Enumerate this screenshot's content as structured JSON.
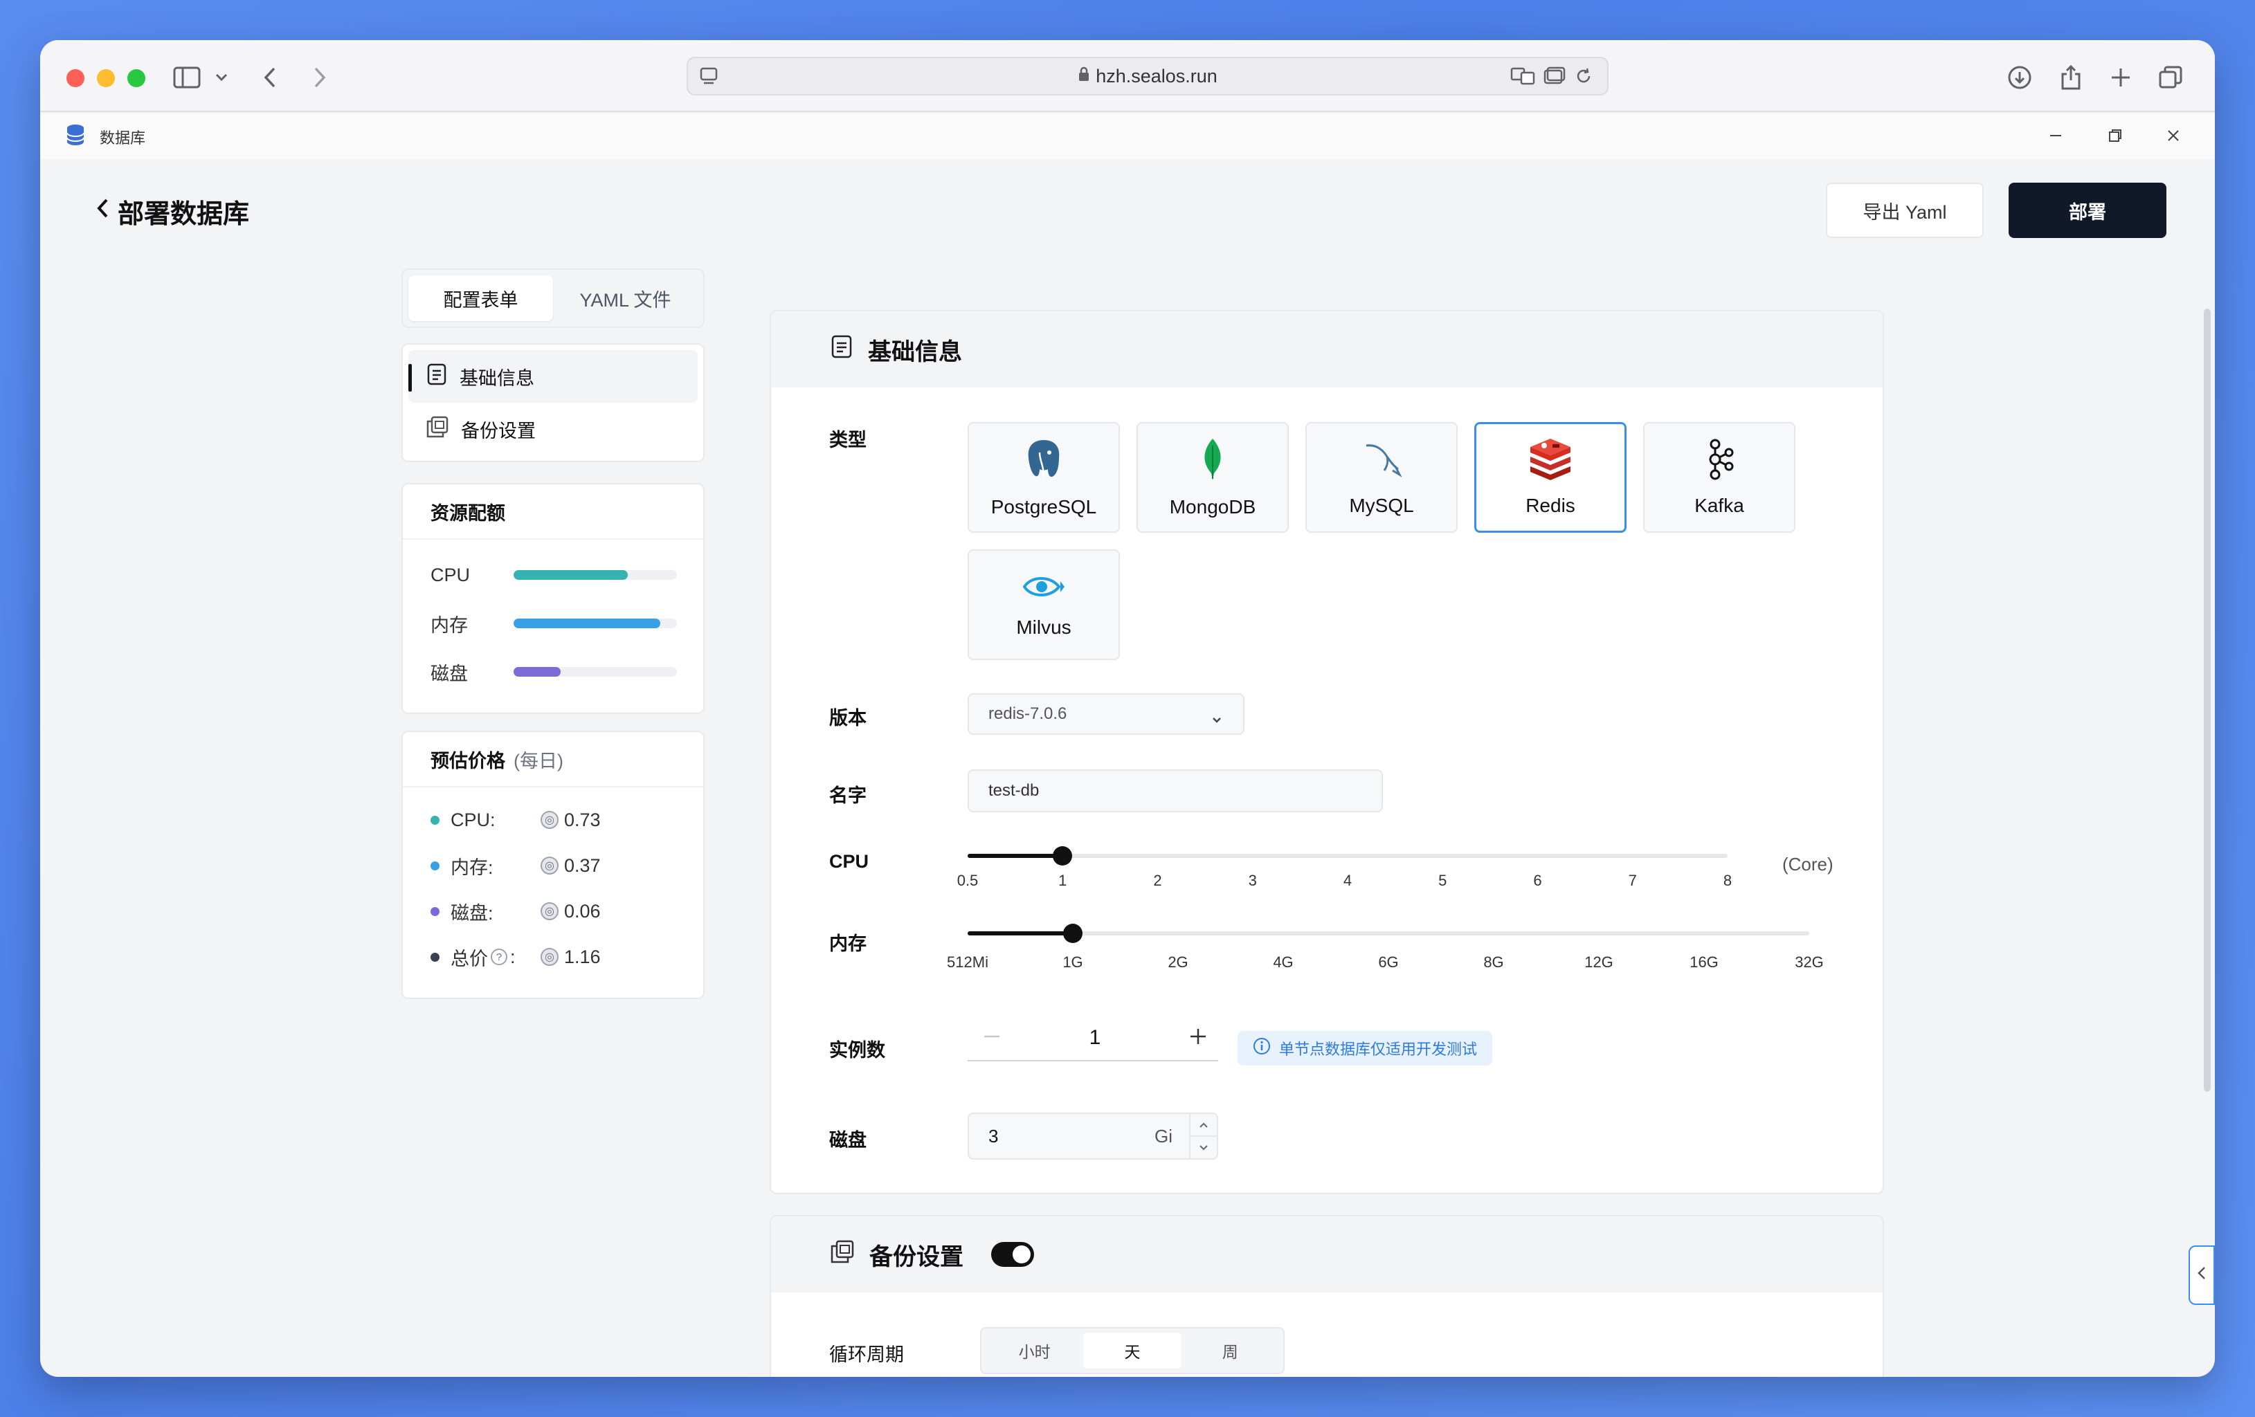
{
  "browser": {
    "url": "hzh.sealos.run"
  },
  "app": {
    "title": "数据库"
  },
  "header": {
    "back_title": "部署数据库",
    "export_label": "导出 Yaml",
    "deploy_label": "部署"
  },
  "sidebar": {
    "tabs": [
      {
        "label": "配置表单",
        "active": true
      },
      {
        "label": "YAML 文件",
        "active": false
      }
    ],
    "nav": [
      {
        "label": "基础信息",
        "active": true
      },
      {
        "label": "备份设置",
        "active": false
      }
    ],
    "resources": {
      "title": "资源配额",
      "items": [
        {
          "label": "CPU",
          "fraction": 0.7,
          "color": "#36b2b0"
        },
        {
          "label": "内存",
          "fraction": 0.9,
          "color": "#3aa0e6"
        },
        {
          "label": "磁盘",
          "fraction": 0.29,
          "color": "#7c6ad6"
        }
      ]
    },
    "price": {
      "title": "预估价格",
      "subtitle": "(每日)",
      "items": [
        {
          "label": "CPU:",
          "value": "0.73",
          "color": "#36b2b0"
        },
        {
          "label": "内存:",
          "value": "0.37",
          "color": "#3aa0e6"
        },
        {
          "label": "磁盘:",
          "value": "0.06",
          "color": "#7c6ad6"
        },
        {
          "label": "总价",
          "value": "1.16",
          "color": "#374151"
        }
      ]
    }
  },
  "main": {
    "title": "基础信息",
    "type_label": "类型",
    "db_types": [
      {
        "name": "PostgreSQL",
        "active": false
      },
      {
        "name": "MongoDB",
        "active": false
      },
      {
        "name": "MySQL",
        "active": false
      },
      {
        "name": "Redis",
        "active": true
      },
      {
        "name": "Kafka",
        "active": false
      },
      {
        "name": "Milvus",
        "active": false
      }
    ],
    "version_label": "版本",
    "version_value": "redis-7.0.6",
    "name_label": "名字",
    "name_value": "test-db",
    "cpu_label": "CPU",
    "cpu_unit": "(Core)",
    "cpu_ticks": [
      "0.5",
      "1",
      "2",
      "3",
      "4",
      "5",
      "6",
      "7",
      "8"
    ],
    "cpu_selected_index": 1,
    "memory_label": "内存",
    "memory_ticks": [
      "512Mi",
      "1G",
      "2G",
      "4G",
      "6G",
      "8G",
      "12G",
      "16G",
      "32G"
    ],
    "memory_selected_index": 1,
    "replicas_label": "实例数",
    "replicas_value": "1",
    "replicas_note": "单节点数据库仅适用开发测试",
    "disk_label": "磁盘",
    "disk_value": "3",
    "disk_unit": "Gi"
  },
  "backup": {
    "title": "备份设置",
    "enabled": true,
    "cycle_label": "循环周期",
    "cycle_options": [
      {
        "label": "小时",
        "active": false
      },
      {
        "label": "天",
        "active": true
      },
      {
        "label": "周",
        "active": false
      }
    ]
  }
}
